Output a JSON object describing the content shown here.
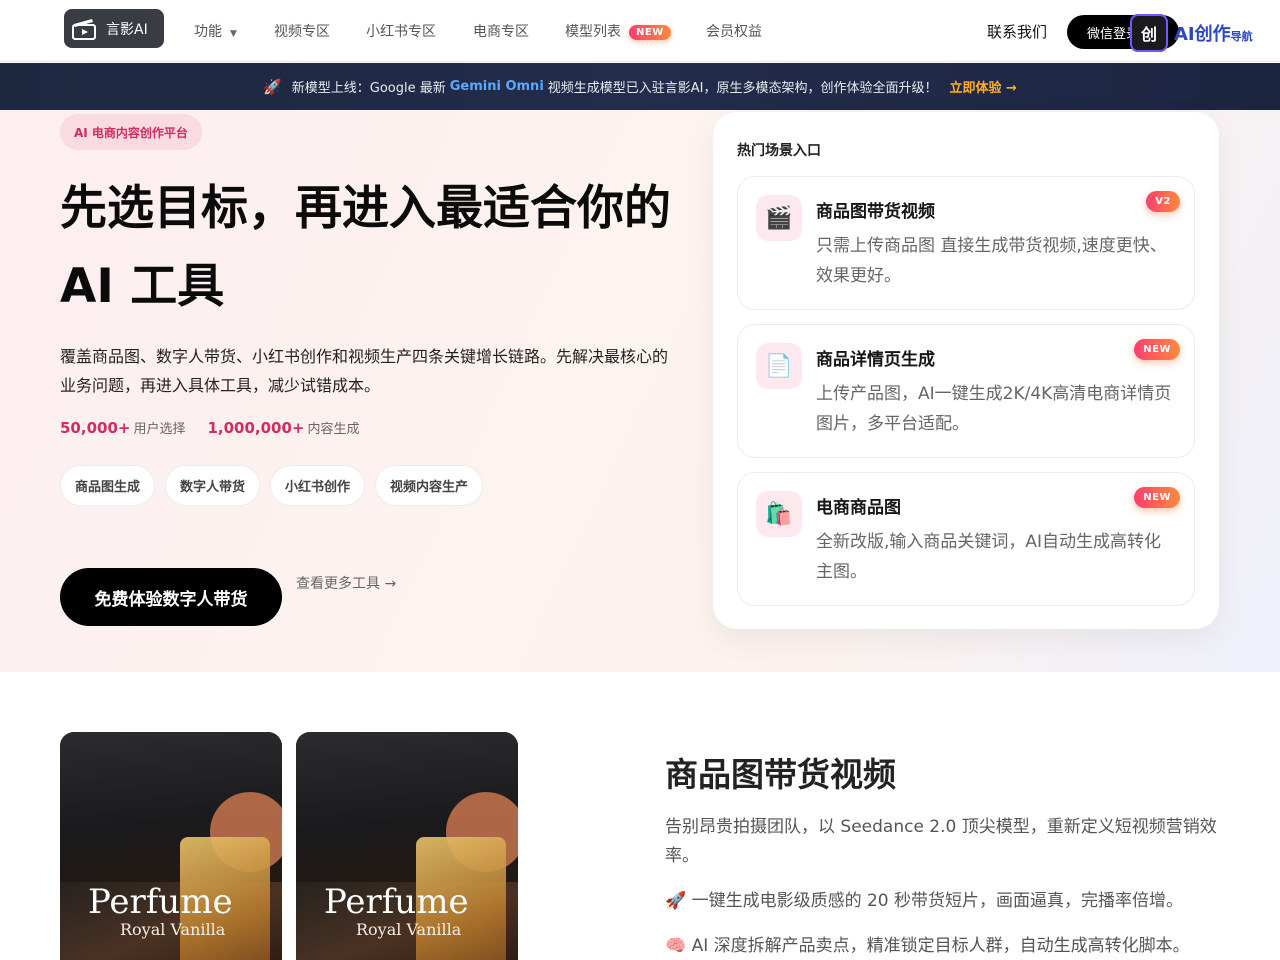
{
  "nav": {
    "logo_text": "言影AI",
    "items": [
      {
        "label": "功能",
        "caret": "▼"
      },
      {
        "label": "视频专区"
      },
      {
        "label": "小红书专区"
      },
      {
        "label": "电商专区"
      },
      {
        "label": "模型列表",
        "badge": "NEW"
      },
      {
        "label": "会员权益"
      }
    ],
    "contact": "联系我们",
    "wechat_login": "微信登录",
    "brand_mark": "创",
    "brand_text": "AI创作",
    "brand_small": "导航"
  },
  "banner": {
    "icon": "🚀",
    "text_before": "新模型上线：Google 最新",
    "highlight": "Gemini Omni",
    "text_after": "视频生成模型已入驻言影AI，原生多模态架构，创作体验全面升级！",
    "cta": "立即体验 →"
  },
  "hero": {
    "tag": "AI 电商内容创作平台",
    "headline": "先选目标，再进入最适合你的 AI 工具",
    "subtitle": "覆盖商品图、数字人带货、小红书创作和视频生产四条关键增长链路。先解决最核心的业务问题，再进入具体工具，减少试错成本。",
    "stats": [
      {
        "value": "50,000+",
        "label": "用户选择"
      },
      {
        "value": "1,000,000+",
        "label": "内容生成"
      }
    ],
    "chips": [
      "商品图生成",
      "数字人带货",
      "小红书创作",
      "视频内容生产"
    ],
    "primary_button": "免费体验数字人带货",
    "more_link": "查看更多工具 →"
  },
  "panel": {
    "title": "热门场景入口",
    "cards": [
      {
        "icon": "🎬",
        "title": "商品图带货视频",
        "desc": "只需上传商品图 直接生成带货视频,速度更快、效果更好。",
        "badge": "V2"
      },
      {
        "icon": "📄",
        "title": "商品详情页生成",
        "desc": "上传产品图，AI一键生成2K/4K高清电商详情页图片，多平台适配。",
        "badge": "NEW"
      },
      {
        "icon": "🛍️",
        "title": "电商商品图",
        "desc": "全新改版,输入商品关键词，AI自动生成高转化主图。",
        "badge": "NEW"
      }
    ]
  },
  "section2": {
    "products": [
      {
        "title": "Perfume",
        "subtitle": "Royal Vanilla"
      },
      {
        "title": "Perfume",
        "subtitle": "Royal Vanilla"
      }
    ],
    "title": "商品图带货视频",
    "desc": "告别昂贵拍摄团队，以 Seedance 2.0 顶尖模型，重新定义短视频营销效率。",
    "bullets": [
      "🚀 一键生成电影级质感的 20 秒带货短片，画面逼真，完播率倍增。",
      "🧠 AI 深度拆解产品卖点，精准锁定目标人群，自动生成高转化脚本。"
    ]
  },
  "colors": {
    "accent": "#d42c5e",
    "banner_bg": "#1d2740",
    "highlight": "#5aa8ff",
    "cta": "#ffb020"
  }
}
